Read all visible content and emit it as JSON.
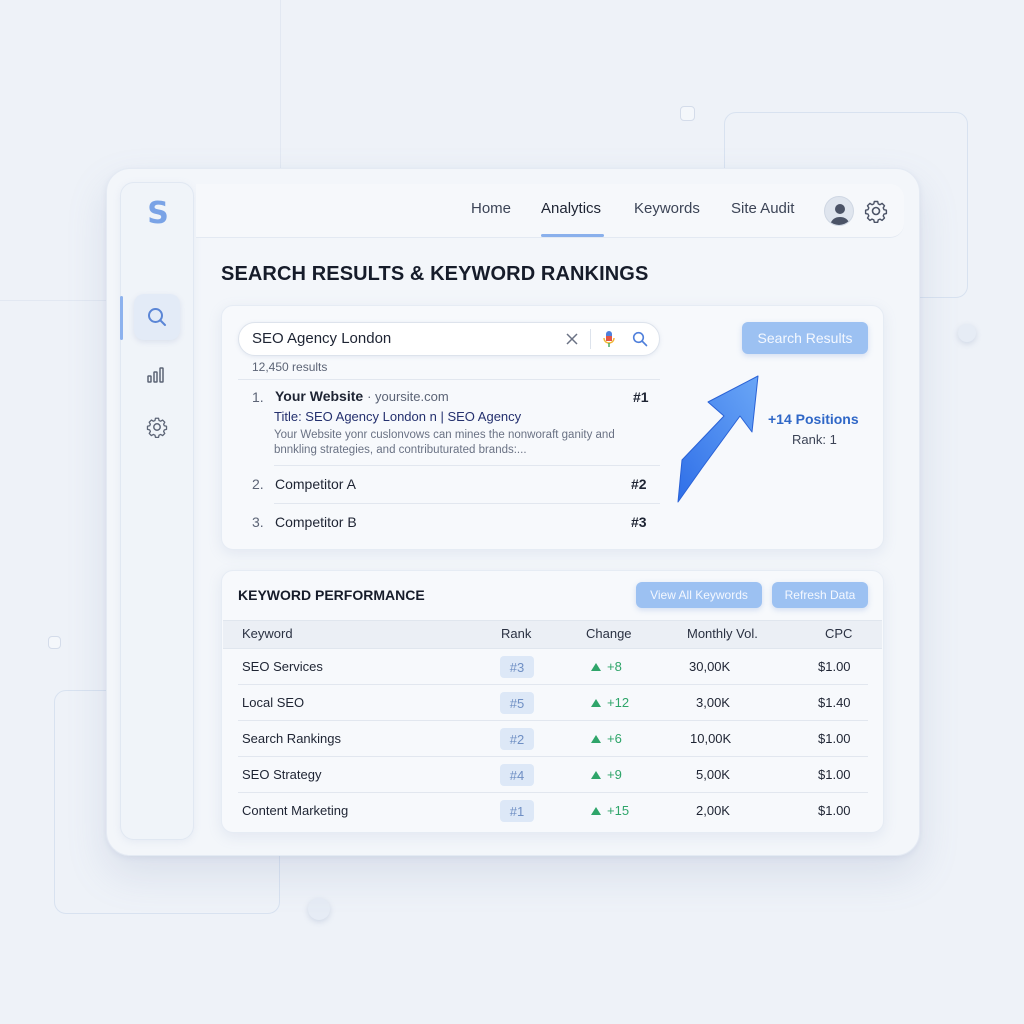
{
  "app": {
    "logo_letter": "S"
  },
  "nav": {
    "items": [
      {
        "label": "Home"
      },
      {
        "label": "Analytics"
      },
      {
        "label": "Keywords"
      },
      {
        "label": "Site Audit"
      }
    ],
    "active": "Analytics"
  },
  "page": {
    "title": "SEARCH RESULTS & KEYWORD RANKINGS"
  },
  "search": {
    "query": "SEO Agency London",
    "results_count": "12,450 results",
    "button_label": "Search Results"
  },
  "results": [
    {
      "num": "1.",
      "title": "Your Website",
      "url": "· yoursite.com",
      "rank": "#1",
      "meta": "Title: SEO Agency London n | SEO Agency",
      "desc": "Your Website yonr cuslonvows can mines the nonworaft ganity and bnnkling strategies, and contributurated brands:..."
    },
    {
      "num": "2.",
      "title": "Competitor A",
      "rank": "#2"
    },
    {
      "num": "3.",
      "title": "Competitor B",
      "rank": "#3"
    }
  ],
  "ranking": {
    "positions": "+14 Positions",
    "rank_text": "Rank: 1"
  },
  "keyword_performance": {
    "title": "KEYWORD PERFORMANCE",
    "view_all_label": "View All Keywords",
    "refresh_label": "Refresh Data",
    "columns": [
      "Keyword",
      "Rank",
      "Change",
      "Monthly Vol.",
      "CPC"
    ],
    "rows": [
      {
        "keyword": "SEO Services",
        "rank": "#3",
        "change": "+8",
        "volume": "30,00K",
        "cpc": "$1.00"
      },
      {
        "keyword": "Local SEO",
        "rank": "#5",
        "change": "+12",
        "volume": "3,00K",
        "cpc": "$1.40"
      },
      {
        "keyword": "Search Rankings",
        "rank": "#2",
        "change": "+6",
        "volume": "10,00K",
        "cpc": "$1.00"
      },
      {
        "keyword": "SEO Strategy",
        "rank": "#4",
        "change": "+9",
        "volume": "5,00K",
        "cpc": "$1.00"
      },
      {
        "keyword": "Content Marketing",
        "rank": "#1",
        "change": "+15",
        "volume": "2,00K",
        "cpc": "$1.00"
      }
    ]
  },
  "colors": {
    "accent": "#8ab0ec",
    "button": "#9cc1f2",
    "positive": "#2fa56a",
    "rank_highlight": "#2f67c7"
  },
  "icons": [
    "search-icon",
    "bar-chart-icon",
    "gear-icon",
    "user-icon",
    "close-icon",
    "microphone-icon",
    "trend-arrow-icon"
  ]
}
